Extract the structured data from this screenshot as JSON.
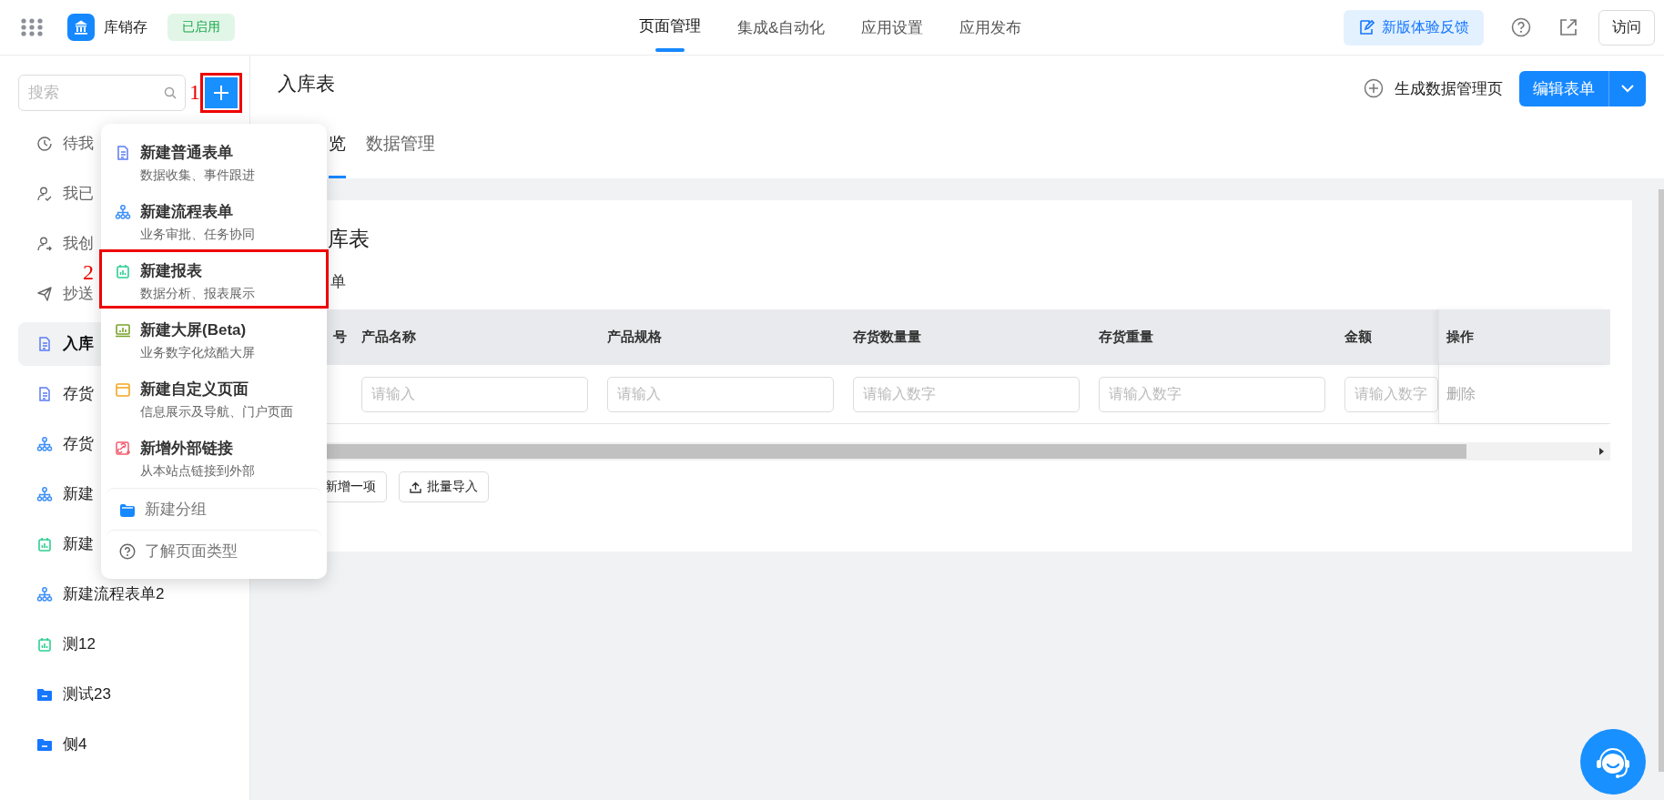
{
  "header": {
    "app_name": "库销存",
    "status_badge": "已启用",
    "nav": [
      {
        "label": "页面管理",
        "selected": true
      },
      {
        "label": "集成&自动化",
        "selected": false
      },
      {
        "label": "应用设置",
        "selected": false
      },
      {
        "label": "应用发布",
        "selected": false
      }
    ],
    "feedback_button": "新版体验反馈",
    "visit_button": "访问"
  },
  "sidebar": {
    "search": {
      "placeholder": "搜索"
    },
    "add_button": {
      "highlighted": true,
      "marker": "1"
    },
    "items": [
      {
        "label": "待我",
        "kind": "todo",
        "selected": false
      },
      {
        "label": "我已",
        "kind": "done",
        "selected": false
      },
      {
        "label": "我创",
        "kind": "created",
        "selected": false
      },
      {
        "label": "抄送",
        "kind": "cc",
        "selected": false
      },
      {
        "label": "入库",
        "kind": "form",
        "selected": true
      },
      {
        "label": "存货",
        "kind": "form",
        "selected": false
      },
      {
        "label": "存货",
        "kind": "flow",
        "selected": false
      },
      {
        "label": "新建",
        "kind": "flow",
        "selected": false
      },
      {
        "label": "新建",
        "kind": "report",
        "selected": false
      },
      {
        "label": "新建流程表单2",
        "kind": "flow",
        "selected": false
      },
      {
        "label": "测12",
        "kind": "report",
        "selected": false
      },
      {
        "label": "测试23",
        "kind": "folder",
        "selected": false
      },
      {
        "label": "侧4",
        "kind": "folder",
        "selected": false
      }
    ]
  },
  "create_menu": {
    "items": [
      {
        "kind": "form",
        "title": "新建普通表单",
        "subtitle": "数据收集、事件跟进",
        "highlighted": false
      },
      {
        "kind": "flow",
        "title": "新建流程表单",
        "subtitle": "业务审批、任务协同",
        "highlighted": false
      },
      {
        "kind": "report",
        "title": "新建报表",
        "subtitle": "数据分析、报表展示",
        "highlighted": true,
        "marker": "2"
      },
      {
        "kind": "screen",
        "title": "新建大屏(Beta)",
        "subtitle": "业务数字化炫酷大屏",
        "highlighted": false
      },
      {
        "kind": "custom",
        "title": "新建自定义页面",
        "subtitle": "信息展示及导航、门户页面",
        "highlighted": false
      },
      {
        "kind": "link",
        "title": "新增外部链接",
        "subtitle": "从本站点链接到外部",
        "highlighted": false
      }
    ],
    "group_item": "新建分组",
    "help_item": "了解页面类型"
  },
  "page": {
    "title": "入库表",
    "generate_action": "生成数据管理页",
    "edit_button": "编辑表单",
    "tabs": [
      {
        "label": "览",
        "selected": true
      },
      {
        "label": "数据管理",
        "selected": false
      }
    ]
  },
  "form_preview": {
    "title": "库表",
    "subform_label": "单",
    "columns": [
      "号",
      "产品名称",
      "产品规格",
      "存货数量量",
      "存货重量",
      "金额",
      "操作"
    ],
    "rows": [
      {
        "fields": [
          {
            "placeholder": "请输入"
          },
          {
            "placeholder": "请输入"
          },
          {
            "placeholder": "请输入数字"
          },
          {
            "placeholder": "请输入数字"
          },
          {
            "placeholder": "请输入数字"
          }
        ],
        "action": "删除"
      }
    ],
    "add_button": "新增一项",
    "import_button": "批量导入"
  }
}
